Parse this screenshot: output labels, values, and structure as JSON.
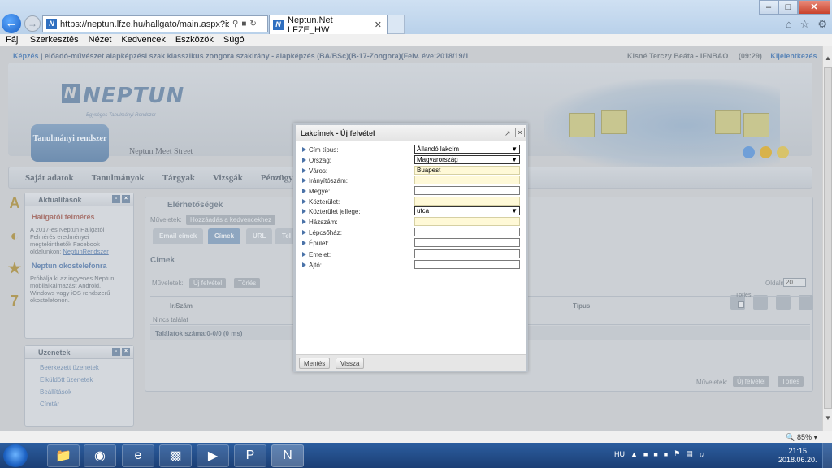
{
  "browser": {
    "url": "https://neptun.lfze.hu/hallgato/main.aspx?ismenu",
    "tab_title": "Neptun.Net LFZE_HW",
    "favicon_letter": "N",
    "menu": [
      "Fájl",
      "Szerkesztés",
      "Nézet",
      "Kedvencek",
      "Eszközök",
      "Súgó"
    ],
    "zoom": "85%"
  },
  "page": {
    "breadcrumb_first": "Képzés",
    "breadcrumb": " | előadó-művészet alapképzési szak klasszikus zongora szakirány - alapképzés (BA/BSc)(B-17-Zongora)(Felv. éve:2018/19/1)[Na...",
    "user": "Kisné Terczy Beáta - IFNBAO",
    "timer": "(09:29)",
    "logout": "Kijelentkezés",
    "logo": "NEPTUN",
    "logo_sub": "Egységes Tanulmányi Rendszer",
    "main_tab": "Tanulmányi rendszer",
    "second_tab": "Neptun Meet Street",
    "nav": [
      "Saját adatok",
      "Tanulmányok",
      "Tárgyak",
      "Vizsgák",
      "Pénzügyek",
      "In"
    ]
  },
  "news": {
    "title": "Aktualitások",
    "item_title": "Hallgatói felmérés",
    "item_body": "A 2017-es Neptun Hallgatói Felmérés eredményei megtekinthetők Facebook oldalunkon:",
    "item_link": "NeptunRendszer",
    "item2_title": "Neptun okostelefonra",
    "item2_body": "Próbálja ki az ingyenes Neptun mobilalkalmazást Android, Windows vagy iOS rendszerű okostelefonon."
  },
  "messages": {
    "title": "Üzenetek",
    "items": [
      "Beérkezett üzenetek",
      "Elküldött üzenetek",
      "Beállítások",
      "Címtár"
    ]
  },
  "content": {
    "title": "Elérhetőségek",
    "ops_label": "Műveletek:",
    "add_fav": "Hozzáadás a kedvencekhez",
    "subtabs": [
      "Email címek",
      "Címek",
      "URL",
      "Tel"
    ],
    "section_title": "Címek",
    "ops_label2": "Műveletek:",
    "new_btn": "Új felvétel",
    "delete_btn": "Törlés",
    "page_size_label": "Oldalméret",
    "page_size": "20",
    "col_irsz": "Ir.Szám",
    "col_tipus": "Típus",
    "col_torles": "Törlés",
    "empty_text": "Nincs találat",
    "count_text": "Találatok száma:0-0/0 (0 ms)",
    "ops_label3": "Műveletek:",
    "new_btn2": "Új felvétel",
    "delete_btn2": "Törlés"
  },
  "modal": {
    "title": "Lakcímek - Új felvétel",
    "fields": [
      {
        "label": "Cím típus:",
        "value": "Állandó lakcím",
        "kind": "select"
      },
      {
        "label": "Ország:",
        "value": "Magyarország",
        "kind": "select"
      },
      {
        "label": "Város:",
        "value": "Buapest",
        "kind": "input-req"
      },
      {
        "label": "Irányítószám:",
        "value": "",
        "kind": "input-req"
      },
      {
        "label": "Megye:",
        "value": "",
        "kind": "input"
      },
      {
        "label": "Közterület:",
        "value": "",
        "kind": "input-req"
      },
      {
        "label": "Közterület jellege:",
        "value": "utca",
        "kind": "select"
      },
      {
        "label": "Házszám:",
        "value": "",
        "kind": "input-req"
      },
      {
        "label": "Lépcsőház:",
        "value": "",
        "kind": "input"
      },
      {
        "label": "Épület:",
        "value": "",
        "kind": "input"
      },
      {
        "label": "Emelet:",
        "value": "",
        "kind": "input"
      },
      {
        "label": "Ajtó:",
        "value": "",
        "kind": "input"
      }
    ],
    "save": "Mentés",
    "back": "Vissza"
  },
  "taskbar": {
    "lang": "HU",
    "time": "21:15",
    "date": "2018.06.20."
  }
}
